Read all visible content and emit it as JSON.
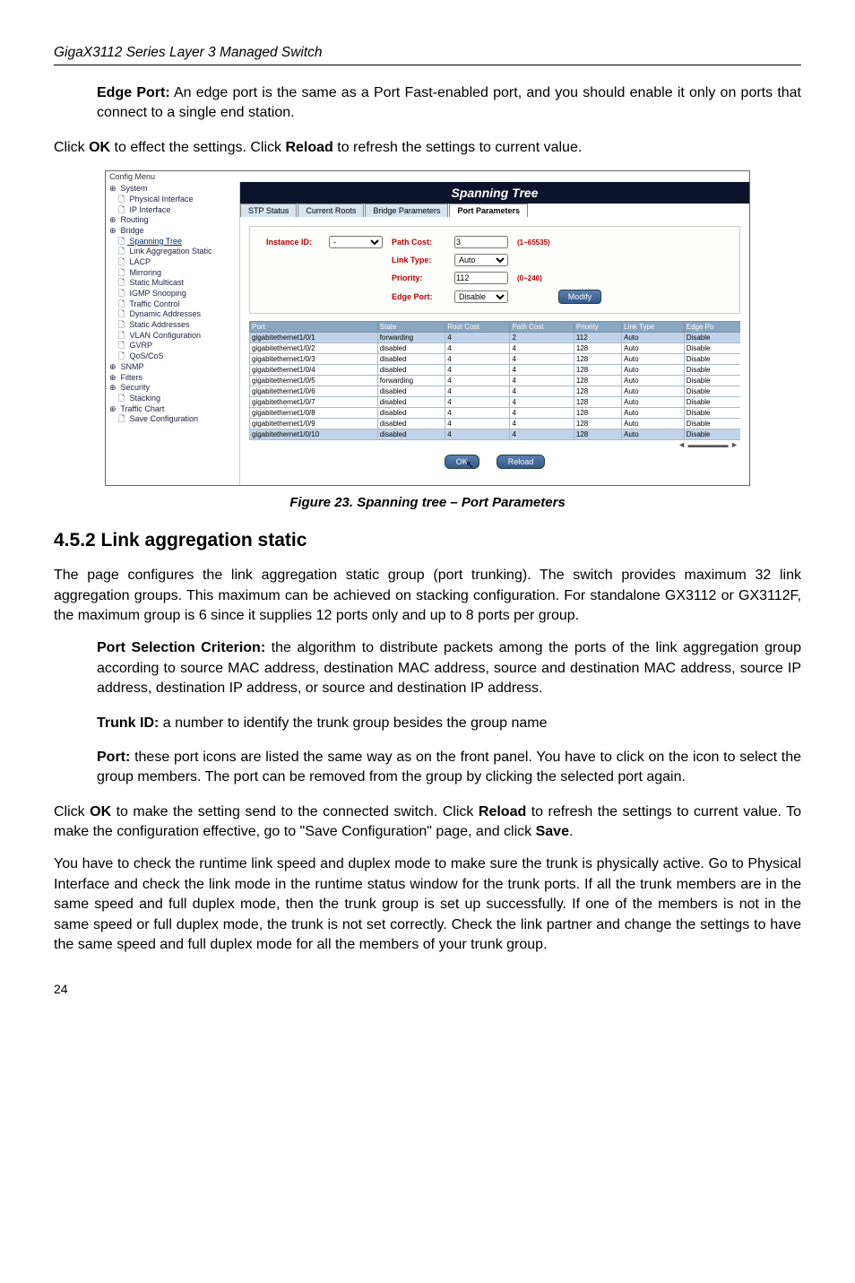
{
  "header": "GigaX3112 Series Layer 3 Managed Switch",
  "para_edgeport": {
    "label": "Edge Port:",
    "text": " An edge port is the same as a Port Fast-enabled port, and you should enable it only on ports that connect to a single end station."
  },
  "para_clickok1_a": "Click ",
  "para_clickok1_b": "OK",
  "para_clickok1_c": " to effect the settings. Click ",
  "para_clickok1_d": "Reload",
  "para_clickok1_e": " to refresh the settings to current value.",
  "switch": {
    "menu_label": "Config Menu",
    "tree": [
      {
        "txt": "System",
        "cls": "node"
      },
      {
        "txt": "Physical Interface",
        "cls": "node pad1"
      },
      {
        "txt": "IP Interface",
        "cls": "node pad1"
      },
      {
        "txt": "Routing",
        "cls": "node"
      },
      {
        "txt": "Bridge",
        "cls": "node"
      },
      {
        "txt": "Spanning Tree",
        "cls": "node pad1 selected"
      },
      {
        "txt": "Link Aggregation Static",
        "cls": "node pad1"
      },
      {
        "txt": "LACP",
        "cls": "node pad1"
      },
      {
        "txt": "Mirroring",
        "cls": "node pad1"
      },
      {
        "txt": "Static Multicast",
        "cls": "node pad1"
      },
      {
        "txt": "IGMP Snooping",
        "cls": "node pad1"
      },
      {
        "txt": "Traffic Control",
        "cls": "node pad1"
      },
      {
        "txt": "Dynamic Addresses",
        "cls": "node pad1"
      },
      {
        "txt": "Static Addresses",
        "cls": "node pad1"
      },
      {
        "txt": "VLAN Configuration",
        "cls": "node pad1"
      },
      {
        "txt": "GVRP",
        "cls": "node pad1"
      },
      {
        "txt": "QoS/CoS",
        "cls": "node pad1"
      },
      {
        "txt": "SNMP",
        "cls": "node"
      },
      {
        "txt": "Filters",
        "cls": "node"
      },
      {
        "txt": "Security",
        "cls": "node"
      },
      {
        "txt": "Stacking",
        "cls": "node pad1"
      },
      {
        "txt": "Traffic Chart",
        "cls": "node"
      },
      {
        "txt": "Save Configuration",
        "cls": "node pad1"
      }
    ],
    "title": "Spanning Tree",
    "tabs": [
      "STP Status",
      "Current Roots",
      "Bridge Parameters",
      "Port Parameters"
    ],
    "active_tab_index": 3,
    "form": {
      "instance_id_lbl": "Instance ID:",
      "instance_id_val": "-",
      "path_cost_lbl": "Path Cost:",
      "path_cost_val": "3",
      "path_cost_range": "(1~65535)",
      "link_type_lbl": "Link Type:",
      "link_type_val": "Auto",
      "priority_lbl": "Priority:",
      "priority_val": "112",
      "priority_range": "(0~240)",
      "edge_port_lbl": "Edge Port:",
      "edge_port_val": "Disable",
      "modify_btn": "Modify"
    },
    "table": {
      "headers": [
        "Port",
        "State",
        "Root Cost",
        "Path Cost",
        "Priority",
        "Link Type",
        "Edge Po"
      ],
      "rows": [
        {
          "cells": [
            "gigabitethernet1/0/1",
            "forwarding",
            "4",
            "2",
            "112",
            "Auto",
            "Disable"
          ],
          "hl": true
        },
        {
          "cells": [
            "gigabitethernet1/0/2",
            "disabled",
            "4",
            "4",
            "128",
            "Auto",
            "Disable"
          ],
          "hl": false
        },
        {
          "cells": [
            "gigabitethernet1/0/3",
            "disabled",
            "4",
            "4",
            "128",
            "Auto",
            "Disable"
          ],
          "hl": false
        },
        {
          "cells": [
            "gigabitethernet1/0/4",
            "disabled",
            "4",
            "4",
            "128",
            "Auto",
            "Disable"
          ],
          "hl": false
        },
        {
          "cells": [
            "gigabitethernet1/0/5",
            "forwarding",
            "4",
            "4",
            "128",
            "Auto",
            "Disable"
          ],
          "hl": false
        },
        {
          "cells": [
            "gigabitethernet1/0/6",
            "disabled",
            "4",
            "4",
            "128",
            "Auto",
            "Disable"
          ],
          "hl": false
        },
        {
          "cells": [
            "gigabitethernet1/0/7",
            "disabled",
            "4",
            "4",
            "128",
            "Auto",
            "Disable"
          ],
          "hl": false
        },
        {
          "cells": [
            "gigabitethernet1/0/8",
            "disabled",
            "4",
            "4",
            "128",
            "Auto",
            "Disable"
          ],
          "hl": false
        },
        {
          "cells": [
            "gigabitethernet1/0/9",
            "disabled",
            "4",
            "4",
            "128",
            "Auto",
            "Disable"
          ],
          "hl": false
        },
        {
          "cells": [
            "gigabitethernet1/0/10",
            "disabled",
            "4",
            "4",
            "128",
            "Auto",
            "Disable"
          ],
          "hl": true
        }
      ]
    },
    "ok_btn": "OK",
    "reload_btn": "Reload"
  },
  "figcaption": "Figure 23. Spanning tree – Port Parameters",
  "section_heading": "4.5.2    Link aggregation static",
  "para_linkagg_intro": "The page configures the link aggregation static group (port trunking). The switch provides maximum 32 link aggregation groups. This maximum can be achieved on stacking configuration. For standalone GX3112 or GX3112F, the maximum group is 6 since it supplies 12 ports only and up to 8 ports per group.",
  "para_portsel": {
    "label": "Port Selection Criterion:",
    "text": " the algorithm to distribute packets among the ports of the link aggregation group according to source MAC address, destination MAC address, source and destination MAC address, source IP address, destination IP address, or source and destination IP address."
  },
  "para_trunkid": {
    "label": "Trunk ID:",
    "text": " a number to identify the trunk group besides the group name"
  },
  "para_port": {
    "label": "Port:",
    "text": " these port icons are listed the same way as on the front panel. You have to click on the icon to select the group members. The port can be removed from the group by clicking the selected port again."
  },
  "para_clickok2_a": "Click ",
  "para_clickok2_b": "OK",
  "para_clickok2_c": " to make the setting send to the connected switch. Click ",
  "para_clickok2_d": "Reload",
  "para_clickok2_e": " to refresh the settings to current value. To make the configuration effective, go to \"Save Configuration\" page, and click ",
  "para_clickok2_f": "Save",
  "para_clickok2_g": ".",
  "para_runtime": "You have to check the runtime link speed and duplex mode to make sure the trunk is physically active. Go to Physical Interface and check the link mode in the runtime status window for the trunk ports. If all the trunk members are in the same speed and full duplex mode, then the trunk group is set up successfully. If one of the members is not in the same speed or full duplex mode, the trunk is not set correctly. Check the link partner and change the settings to have the same speed and full duplex mode for all the members of your trunk group.",
  "page_number": "24"
}
